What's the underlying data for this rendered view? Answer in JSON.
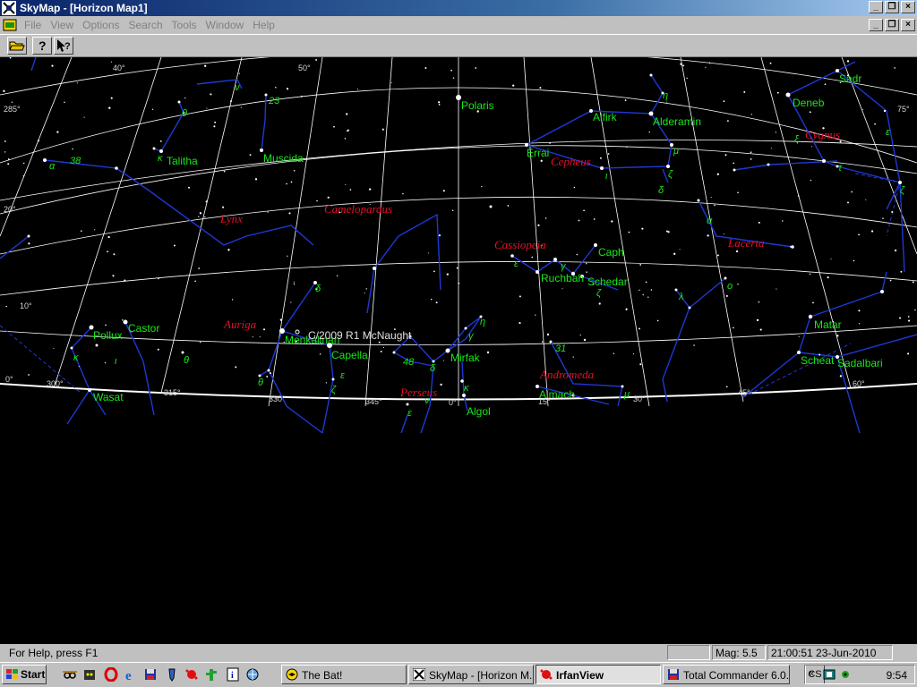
{
  "window": {
    "title": "SkyMap - [Horizon Map1]",
    "controls": [
      "_",
      "❐",
      "×"
    ]
  },
  "menu": {
    "items": [
      "File",
      "View",
      "Options",
      "Search",
      "Tools",
      "Window",
      "Help"
    ]
  },
  "map": {
    "stars": {
      "polaris": "Polaris",
      "alfirk": "Alfirk",
      "alderamin": "Alderamin",
      "errai": "Errai",
      "deneb": "Deneb",
      "sadr": "Sadr",
      "talitha": "Talitha",
      "muscida": "Muscida",
      "caph": "Caph",
      "ruchbah": "Ruchbah",
      "schedar": "Schedar",
      "pollux": "Pollux",
      "castor": "Castor",
      "menkalinan": "Menkalinan",
      "capella": "Capella",
      "mirfak": "Mirfak",
      "algol": "Algol",
      "almach": "Almach",
      "wasat": "Wasat",
      "matar": "Matar",
      "scheat": "Scheat",
      "sadalbari": "Sadalbari"
    },
    "constellations": {
      "lynx": "Lynx",
      "camelopardus": "Camelopardus",
      "cepheus": "Cepheus",
      "cygnus": "Cygnus",
      "cassiopeia": "Cassiopeia",
      "lacerta": "Lacerta",
      "auriga": "Auriga",
      "andromeda": "Andromeda",
      "perseus": "Perseus"
    },
    "comet": "C/2009 R1 McNaught",
    "altitude_labels": [
      "40°",
      "50°",
      "20°",
      "10°",
      "0°"
    ],
    "azimuth_labels": [
      "300°",
      "315°",
      "330°",
      "345°",
      "0°",
      "15°",
      "30°",
      "45°",
      "60°"
    ],
    "edge_labels": [
      "285°",
      "75°"
    ],
    "greek": {
      "alpha": "α",
      "beta": "β",
      "gamma": "γ",
      "delta": "δ",
      "epsilon": "ε",
      "zeta": "ζ",
      "eta": "η",
      "theta": "θ",
      "iota": "ι",
      "kappa": "κ",
      "lambda": "λ",
      "mu": "μ",
      "nu": "ν",
      "xi": "ξ",
      "omicron": "ο",
      "tau": "τ"
    },
    "numbers": {
      "n38": "38",
      "n23": "23",
      "n48": "48",
      "n31": "31"
    },
    "colors": {
      "background": "#000000",
      "star_label": "#18e818",
      "constellation_label": "#e8102a",
      "constellation_line": "#1e38d6",
      "grid": "#ffffff"
    }
  },
  "status": {
    "help": "For Help, press F1",
    "mag": "Mag: 5.5",
    "datetime": "21:00:51 23-Jun-2010"
  },
  "taskbar": {
    "start": "Start",
    "tasks": [
      "The Bat!",
      "SkyMap - [Horizon M...",
      "IrfanView",
      "Total Commander 6.0..."
    ],
    "lang": "CS",
    "clock": "9:54"
  }
}
